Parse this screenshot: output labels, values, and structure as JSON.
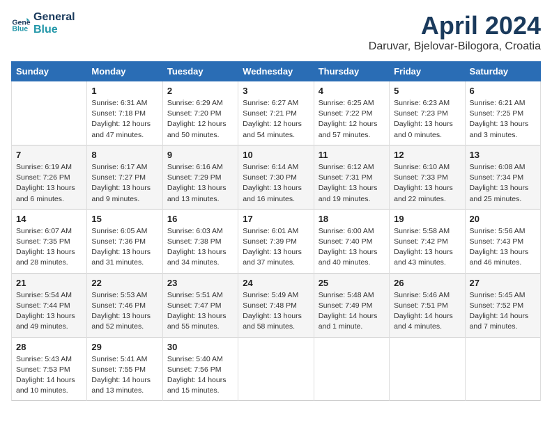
{
  "header": {
    "logo_line1": "General",
    "logo_line2": "Blue",
    "title": "April 2024",
    "subtitle": "Daruvar, Bjelovar-Bilogora, Croatia"
  },
  "weekdays": [
    "Sunday",
    "Monday",
    "Tuesday",
    "Wednesday",
    "Thursday",
    "Friday",
    "Saturday"
  ],
  "weeks": [
    [
      {
        "day": "",
        "info": ""
      },
      {
        "day": "1",
        "info": "Sunrise: 6:31 AM\nSunset: 7:18 PM\nDaylight: 12 hours\nand 47 minutes."
      },
      {
        "day": "2",
        "info": "Sunrise: 6:29 AM\nSunset: 7:20 PM\nDaylight: 12 hours\nand 50 minutes."
      },
      {
        "day": "3",
        "info": "Sunrise: 6:27 AM\nSunset: 7:21 PM\nDaylight: 12 hours\nand 54 minutes."
      },
      {
        "day": "4",
        "info": "Sunrise: 6:25 AM\nSunset: 7:22 PM\nDaylight: 12 hours\nand 57 minutes."
      },
      {
        "day": "5",
        "info": "Sunrise: 6:23 AM\nSunset: 7:23 PM\nDaylight: 13 hours\nand 0 minutes."
      },
      {
        "day": "6",
        "info": "Sunrise: 6:21 AM\nSunset: 7:25 PM\nDaylight: 13 hours\nand 3 minutes."
      }
    ],
    [
      {
        "day": "7",
        "info": "Sunrise: 6:19 AM\nSunset: 7:26 PM\nDaylight: 13 hours\nand 6 minutes."
      },
      {
        "day": "8",
        "info": "Sunrise: 6:17 AM\nSunset: 7:27 PM\nDaylight: 13 hours\nand 9 minutes."
      },
      {
        "day": "9",
        "info": "Sunrise: 6:16 AM\nSunset: 7:29 PM\nDaylight: 13 hours\nand 13 minutes."
      },
      {
        "day": "10",
        "info": "Sunrise: 6:14 AM\nSunset: 7:30 PM\nDaylight: 13 hours\nand 16 minutes."
      },
      {
        "day": "11",
        "info": "Sunrise: 6:12 AM\nSunset: 7:31 PM\nDaylight: 13 hours\nand 19 minutes."
      },
      {
        "day": "12",
        "info": "Sunrise: 6:10 AM\nSunset: 7:33 PM\nDaylight: 13 hours\nand 22 minutes."
      },
      {
        "day": "13",
        "info": "Sunrise: 6:08 AM\nSunset: 7:34 PM\nDaylight: 13 hours\nand 25 minutes."
      }
    ],
    [
      {
        "day": "14",
        "info": "Sunrise: 6:07 AM\nSunset: 7:35 PM\nDaylight: 13 hours\nand 28 minutes."
      },
      {
        "day": "15",
        "info": "Sunrise: 6:05 AM\nSunset: 7:36 PM\nDaylight: 13 hours\nand 31 minutes."
      },
      {
        "day": "16",
        "info": "Sunrise: 6:03 AM\nSunset: 7:38 PM\nDaylight: 13 hours\nand 34 minutes."
      },
      {
        "day": "17",
        "info": "Sunrise: 6:01 AM\nSunset: 7:39 PM\nDaylight: 13 hours\nand 37 minutes."
      },
      {
        "day": "18",
        "info": "Sunrise: 6:00 AM\nSunset: 7:40 PM\nDaylight: 13 hours\nand 40 minutes."
      },
      {
        "day": "19",
        "info": "Sunrise: 5:58 AM\nSunset: 7:42 PM\nDaylight: 13 hours\nand 43 minutes."
      },
      {
        "day": "20",
        "info": "Sunrise: 5:56 AM\nSunset: 7:43 PM\nDaylight: 13 hours\nand 46 minutes."
      }
    ],
    [
      {
        "day": "21",
        "info": "Sunrise: 5:54 AM\nSunset: 7:44 PM\nDaylight: 13 hours\nand 49 minutes."
      },
      {
        "day": "22",
        "info": "Sunrise: 5:53 AM\nSunset: 7:46 PM\nDaylight: 13 hours\nand 52 minutes."
      },
      {
        "day": "23",
        "info": "Sunrise: 5:51 AM\nSunset: 7:47 PM\nDaylight: 13 hours\nand 55 minutes."
      },
      {
        "day": "24",
        "info": "Sunrise: 5:49 AM\nSunset: 7:48 PM\nDaylight: 13 hours\nand 58 minutes."
      },
      {
        "day": "25",
        "info": "Sunrise: 5:48 AM\nSunset: 7:49 PM\nDaylight: 14 hours\nand 1 minute."
      },
      {
        "day": "26",
        "info": "Sunrise: 5:46 AM\nSunset: 7:51 PM\nDaylight: 14 hours\nand 4 minutes."
      },
      {
        "day": "27",
        "info": "Sunrise: 5:45 AM\nSunset: 7:52 PM\nDaylight: 14 hours\nand 7 minutes."
      }
    ],
    [
      {
        "day": "28",
        "info": "Sunrise: 5:43 AM\nSunset: 7:53 PM\nDaylight: 14 hours\nand 10 minutes."
      },
      {
        "day": "29",
        "info": "Sunrise: 5:41 AM\nSunset: 7:55 PM\nDaylight: 14 hours\nand 13 minutes."
      },
      {
        "day": "30",
        "info": "Sunrise: 5:40 AM\nSunset: 7:56 PM\nDaylight: 14 hours\nand 15 minutes."
      },
      {
        "day": "",
        "info": ""
      },
      {
        "day": "",
        "info": ""
      },
      {
        "day": "",
        "info": ""
      },
      {
        "day": "",
        "info": ""
      }
    ]
  ]
}
